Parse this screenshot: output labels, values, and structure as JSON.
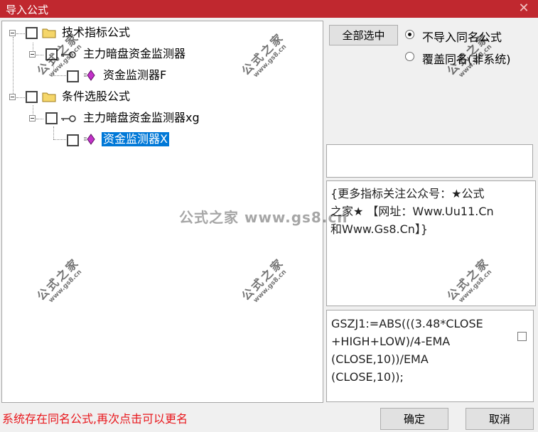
{
  "window": {
    "title": "导入公式",
    "close_glyph": "✕"
  },
  "tree": {
    "group1": {
      "label": "技术指标公式",
      "child": {
        "label": "主力暗盘资金监测器",
        "leaf": "资金监测器F"
      }
    },
    "group2": {
      "label": "条件选股公式",
      "child": {
        "label": "主力暗盘资金监测器xg",
        "leaf": "资金监测器X"
      }
    }
  },
  "options": {
    "select_all": "全部选中",
    "radio_no_import": "不导入同名公式",
    "radio_overwrite": "覆盖同名(非系统)",
    "selected_radio": "no_import"
  },
  "description": {
    "line1": "{更多指标关注公众号：★公式",
    "line2": "之家★ 【网址：Www.Uu11.Cn",
    "line3": "和Www.Gs8.Cn】}"
  },
  "formula": {
    "line1": "GSZJ1:=ABS(((3.48*CLOSE",
    "line2": "+HIGH+LOW)/4-EMA",
    "line3": "(CLOSE,10))/EMA",
    "line4": "(CLOSE,10));"
  },
  "status_message": "系统存在同名公式,再次点击可以更名",
  "buttons": {
    "ok": "确定",
    "cancel": "取消"
  },
  "watermark": {
    "main": "公式之家 www.gs8.cn",
    "stamp_top": "公式之家",
    "stamp_bottom": "www.gs8.cn"
  },
  "colors": {
    "titlebar": "#c0282f",
    "selection": "#0078d7",
    "status": "#e8161b"
  }
}
